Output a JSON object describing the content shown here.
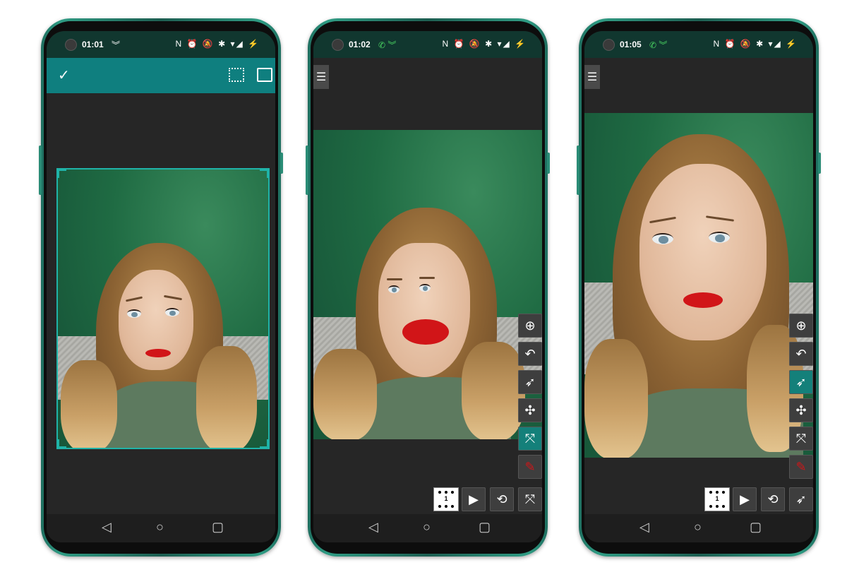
{
  "phones": [
    {
      "status": {
        "time": "01:01",
        "icons_left": "︾",
        "icons_right": "N ⏰ 🔕 ✱ ▾◢ ⚡"
      },
      "appbar": {
        "confirm_icon": "check-icon",
        "fit_icon": "fit-crop-icon",
        "aspect_icon": "aspect-ratio-icon"
      },
      "colors": {
        "appbar": "#0f7f7f",
        "crop_frame": "#1fb3a8"
      }
    },
    {
      "status": {
        "time": "01:02",
        "icons_left": "✆ ︾",
        "icons_right": "N ⏰ 🔕 ✱ ▾◢ ⚡"
      },
      "menu_label": "☰",
      "tools": [
        "zoom-icon",
        "undo-icon",
        "warp-icon",
        "expand-icon",
        "shrink-icon",
        "brush-icon"
      ],
      "active_tool": "shrink-icon",
      "bottom_tools": {
        "frame_label": "1",
        "play": "▶",
        "film_reset": "⟲",
        "shrink": "⤧"
      },
      "colors": {
        "active": "#14807a",
        "lips": "#d11518"
      }
    },
    {
      "status": {
        "time": "01:05",
        "icons_left": "✆ ︾",
        "icons_right": "N ⏰ 🔕 ✱ ▾◢ ⚡"
      },
      "menu_label": "☰",
      "tools": [
        "zoom-icon",
        "undo-icon",
        "warp-icon",
        "expand-icon",
        "shrink-icon",
        "brush-icon"
      ],
      "active_tool": "warp-icon",
      "bottom_tools": {
        "frame_label": "1",
        "play": "▶",
        "film_reset": "⟲",
        "warp": "➶"
      },
      "colors": {
        "active": "#14807a",
        "lips": "#d11518"
      }
    }
  ],
  "navbar": {
    "back": "◁",
    "home": "○",
    "recents": "▢"
  }
}
